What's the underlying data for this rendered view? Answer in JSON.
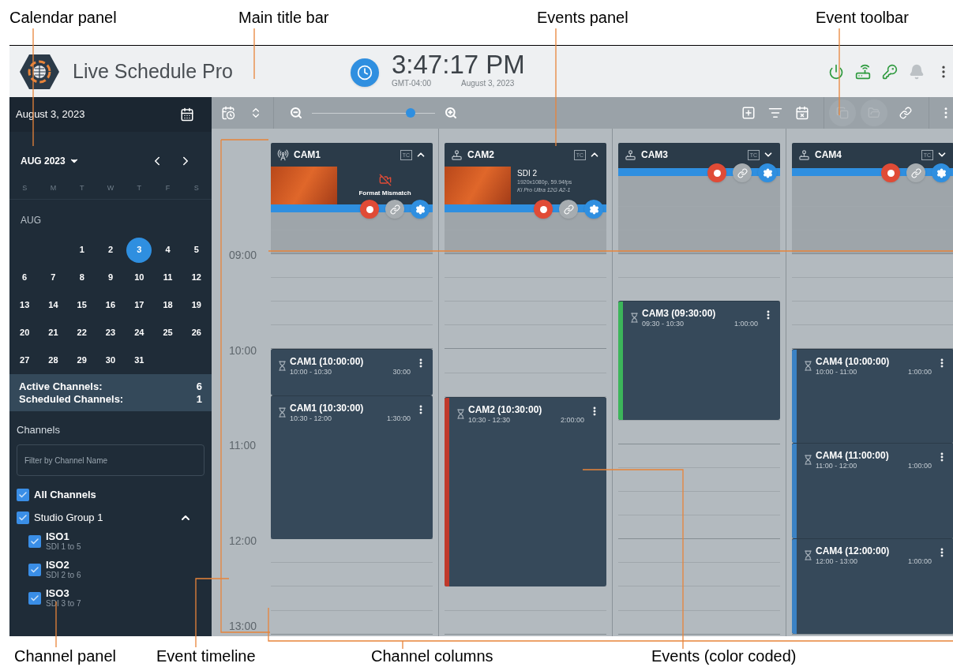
{
  "callouts_top": [
    {
      "label": "Calendar panel"
    },
    {
      "label": "Main title bar"
    },
    {
      "label": "Events panel"
    },
    {
      "label": "Event toolbar"
    }
  ],
  "callouts_bottom": [
    {
      "label": "Channel panel"
    },
    {
      "label": "Event timeline"
    },
    {
      "label": "Channel columns"
    },
    {
      "label": "Events (color coded)"
    }
  ],
  "title_bar": {
    "app_name": "Live Schedule Pro",
    "clock": {
      "time": "3:47:17 PM",
      "timezone": "GMT-04:00",
      "date": "August 3, 2023"
    }
  },
  "sidebar": {
    "date": "August 3, 2023",
    "month_picker": "AUG 2023",
    "weekdays": [
      "S",
      "M",
      "T",
      "W",
      "T",
      "F",
      "S"
    ],
    "month_label": "AUG",
    "days": [
      {
        "day": "1",
        "selected": false
      },
      {
        "day": "2",
        "selected": false
      },
      {
        "day": "3",
        "selected": true
      },
      {
        "day": "4",
        "selected": false
      },
      {
        "day": "5",
        "selected": false
      },
      {
        "day": "6",
        "selected": false
      },
      {
        "day": "7",
        "selected": false
      },
      {
        "day": "8",
        "selected": false
      },
      {
        "day": "9",
        "selected": false
      },
      {
        "day": "10",
        "selected": false
      },
      {
        "day": "11",
        "selected": false
      },
      {
        "day": "12",
        "selected": false
      },
      {
        "day": "13",
        "selected": false
      },
      {
        "day": "14",
        "selected": false
      },
      {
        "day": "15",
        "selected": false
      },
      {
        "day": "16",
        "selected": false
      },
      {
        "day": "17",
        "selected": false
      },
      {
        "day": "18",
        "selected": false
      },
      {
        "day": "19",
        "selected": false
      },
      {
        "day": "20",
        "selected": false
      },
      {
        "day": "21",
        "selected": false
      },
      {
        "day": "22",
        "selected": false
      },
      {
        "day": "23",
        "selected": false
      },
      {
        "day": "24",
        "selected": false
      },
      {
        "day": "25",
        "selected": false
      },
      {
        "day": "26",
        "selected": false
      },
      {
        "day": "27",
        "selected": false
      },
      {
        "day": "28",
        "selected": false
      },
      {
        "day": "29",
        "selected": false
      },
      {
        "day": "30",
        "selected": false
      },
      {
        "day": "31",
        "selected": false
      }
    ],
    "stats": [
      {
        "label": "Active Channels:",
        "value": "6"
      },
      {
        "label": "Scheduled Channels:",
        "value": "1"
      }
    ],
    "channels_heading": "Channels",
    "filter": {
      "placeholder": "Filter by Channel Name"
    },
    "all_channels": {
      "label": "All Channels",
      "checked": true
    },
    "groups": [
      {
        "label": "Studio Group 1",
        "checked": true,
        "expanded": true,
        "children": [
          {
            "name": "ISO1",
            "source": "SDI 1 to 5",
            "checked": true
          },
          {
            "name": "ISO2",
            "source": "SDI 2 to 6",
            "checked": true
          },
          {
            "name": "ISO3",
            "source": "SDI 3 to 7",
            "checked": true
          }
        ]
      }
    ]
  },
  "toolbar": {
    "zoom": {
      "level": 0.8
    },
    "event_actions": [
      {
        "disabled": true
      },
      {
        "disabled": true
      },
      {
        "disabled": false
      }
    ]
  },
  "timeline": {
    "hours": [
      "09:00",
      "10:00",
      "11:00",
      "12:00",
      "13:00"
    ]
  },
  "columns": [
    {
      "name": "CAM1",
      "kind": "antenna",
      "tc_label": "TC",
      "expanded": true,
      "preview": {
        "kind": "warning",
        "status": "Format Mismatch"
      },
      "events": [
        {
          "title": "CAM1 (10:00:00)",
          "range": "10:00 - 10:30",
          "duration": "30:00"
        },
        {
          "title": "CAM1 (10:30:00)",
          "range": "10:30 - 12:00",
          "duration": "1:30:00"
        }
      ]
    },
    {
      "name": "CAM2",
      "kind": "joystick",
      "tc_label": "TC",
      "expanded": true,
      "preview": {
        "kind": "info",
        "input": "SDI 2",
        "format": "1920x1080p, 59.94fps",
        "device": "Ki Pro Ultra 12G A2-1"
      },
      "events": [
        {
          "title": "CAM2 (10:30:00)",
          "range": "10:30 - 12:30",
          "duration": "2:00:00",
          "color": "#c0392b"
        }
      ]
    },
    {
      "name": "CAM3",
      "kind": "joystick",
      "tc_label": "TC",
      "expanded": false,
      "events": [
        {
          "title": "CAM3 (09:30:00)",
          "range": "09:30 - 10:30",
          "duration": "1:00:00",
          "color": "#3cb55a"
        }
      ]
    },
    {
      "name": "CAM4",
      "kind": "joystick",
      "tc_label": "TC",
      "expanded": false,
      "events": [
        {
          "title": "CAM4 (10:00:00)",
          "range": "10:00 - 11:00",
          "duration": "1:00:00",
          "color": "#3b82c4"
        },
        {
          "title": "CAM4 (11:00:00)",
          "range": "11:00 - 12:00",
          "duration": "1:00:00",
          "color": "#3b82c4"
        },
        {
          "title": "CAM4 (12:00:00)",
          "range": "12:00 - 13:00",
          "duration": "1:00:00",
          "color": "#3b82c4"
        }
      ]
    }
  ]
}
